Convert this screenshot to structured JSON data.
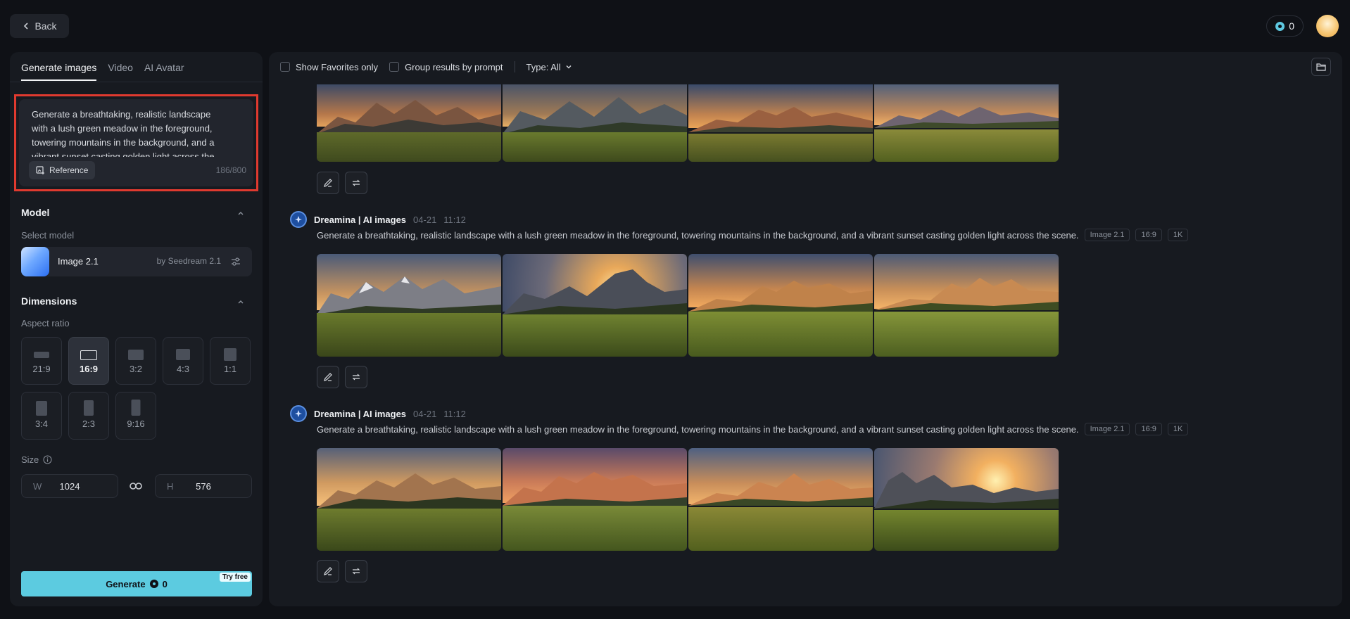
{
  "topbar": {
    "back_label": "Back",
    "credits": "0"
  },
  "tabs": [
    {
      "label": "Generate images",
      "active": true
    },
    {
      "label": "Video",
      "active": false
    },
    {
      "label": "AI Avatar",
      "active": false
    }
  ],
  "prompt": {
    "text": "Generate a breathtaking, realistic landscape with a lush green meadow in the foreground, towering mountains in the background, and a vibrant sunset casting golden light across the scene.",
    "reference_label": "Reference",
    "counter": "186/800"
  },
  "model": {
    "section_title": "Model",
    "select_label": "Select model",
    "name": "Image 2.1",
    "by": "by Seedream 2.1"
  },
  "dimensions": {
    "section_title": "Dimensions",
    "aspect_label": "Aspect ratio",
    "ratios": [
      "21:9",
      "16:9",
      "3:2",
      "4:3",
      "1:1",
      "3:4",
      "2:3",
      "9:16"
    ],
    "selected": "16:9",
    "size_label": "Size",
    "width_prefix": "W",
    "width": "1024",
    "height_prefix": "H",
    "height": "576"
  },
  "generate": {
    "label": "Generate",
    "cost": "0",
    "badge": "Try free"
  },
  "filters": {
    "favorites_label": "Show Favorites only",
    "group_label": "Group results by prompt",
    "type_label": "Type: All"
  },
  "groups": [
    {
      "title": "Dreamina | AI images",
      "date": "04-21",
      "time": "11:12",
      "prompt": "Generate a breathtaking, realistic landscape with a lush green meadow in the foreground, towering mountains in the background, and a vibrant sunset casting golden light across the scene.",
      "tags": [
        "Image 2.1",
        "16:9",
        "1K"
      ]
    },
    {
      "title": "Dreamina | AI images",
      "date": "04-21",
      "time": "11:12",
      "prompt": "Generate a breathtaking, realistic landscape with a lush green meadow in the foreground, towering mountains in the background, and a vibrant sunset casting golden light across the scene.",
      "tags": [
        "Image 2.1",
        "16:9",
        "1K"
      ]
    }
  ],
  "colors": {
    "accent": "#5ccbe0",
    "highlight": "#e03a2f",
    "background": "#0f1116",
    "panel": "#171a20"
  }
}
